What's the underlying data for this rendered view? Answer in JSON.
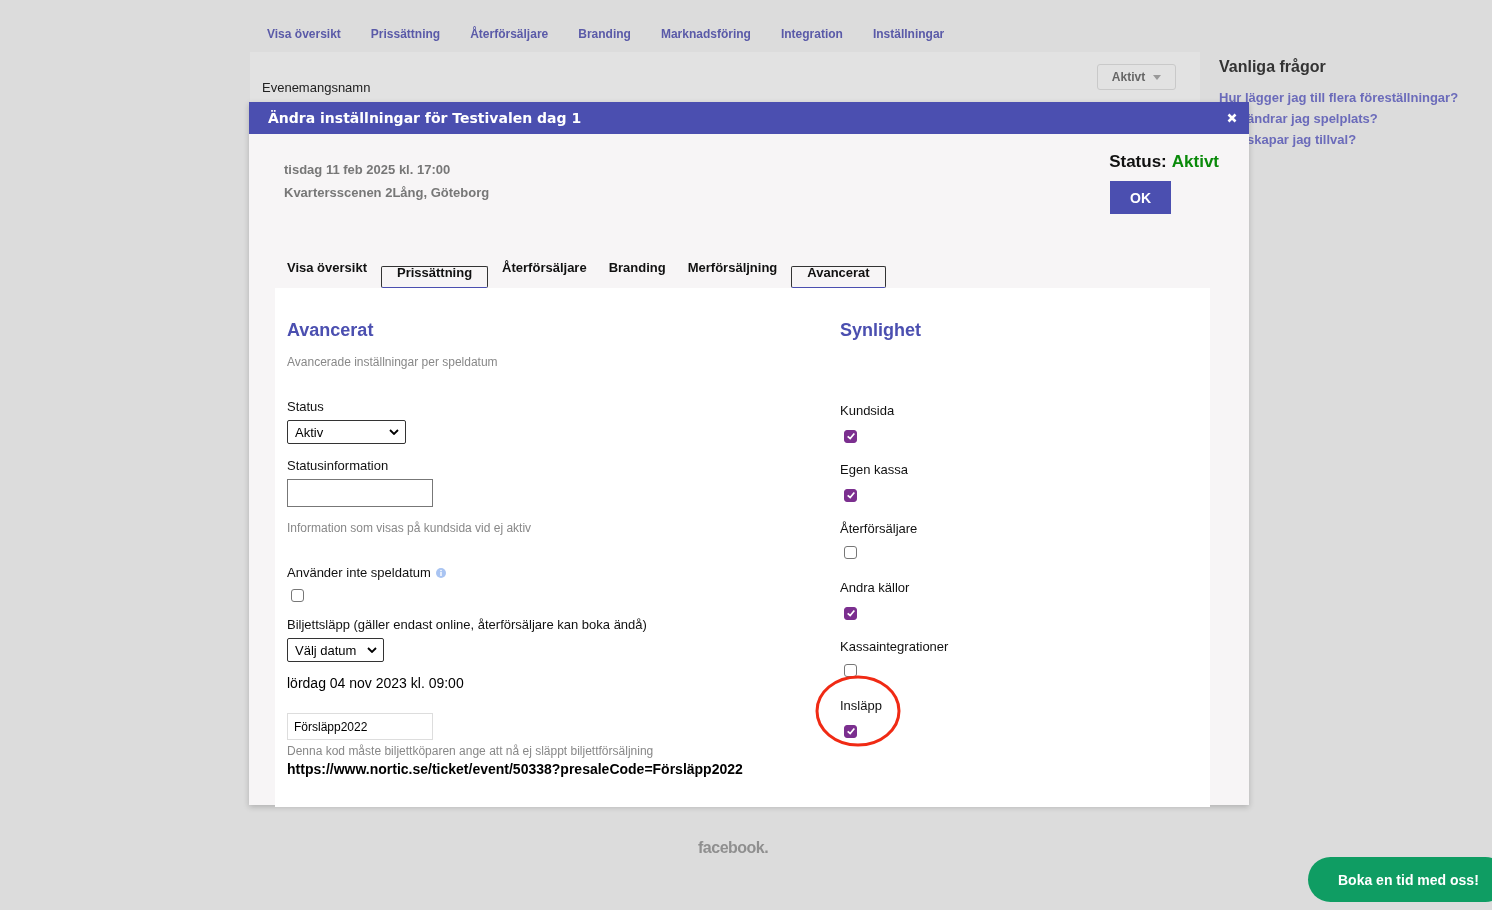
{
  "top_nav": [
    {
      "label": "Visa översikt"
    },
    {
      "label": "Prissättning"
    },
    {
      "label": "Återförsäljare"
    },
    {
      "label": "Branding"
    },
    {
      "label": "Marknadsföring"
    },
    {
      "label": "Integration"
    },
    {
      "label": "Inställningar"
    }
  ],
  "page": {
    "event_name_label": "Evenemangsnamn",
    "status_button": "Aktivt"
  },
  "faq": {
    "title": "Vanliga frågor",
    "links": [
      "Hur lägger jag till flera föreställningar?",
      "ändrar jag spelplats?",
      "skapar jag tillval?"
    ]
  },
  "footer": {
    "logo": "facebook."
  },
  "book_button": "Boka en tid med oss!",
  "modal": {
    "title": "Ändra inställningar för Testivalen dag 1",
    "date": "tisdag 11 feb 2025 kl. 17:00",
    "venue": "Kvartersscenen 2Lång, Göteborg",
    "status_label": "Status:",
    "status_value": "Aktivt",
    "ok_button": "OK",
    "tabs": [
      {
        "label": "Visa översikt",
        "selected": false
      },
      {
        "label": "Prissättning",
        "selected": true
      },
      {
        "label": "Återförsäljare",
        "selected": false
      },
      {
        "label": "Branding",
        "selected": false
      },
      {
        "label": "Merförsäljning",
        "selected": false
      },
      {
        "label": "Avancerat",
        "selected": true
      }
    ],
    "advanced": {
      "title": "Avancerat",
      "subtitle": "Avancerade inställningar per speldatum",
      "status_label": "Status",
      "status_select": "Aktiv",
      "status_info_label": "Statusinformation",
      "status_info_hint": "Information som visas på kundsida vid ej aktiv",
      "no_date_label": "Använder inte speldatum",
      "no_date_checked": false,
      "release_label": "Biljettsläpp (gäller endast online, återförsäljare kan boka ändå)",
      "release_select": "Välj datum",
      "release_date": "lördag 04 nov 2023 kl. 09:00",
      "code_value": "Försläpp2022",
      "code_hint": "Denna kod måste biljettköparen ange att nå ej släppt biljettförsäljning",
      "code_url": "https://www.nortic.se/ticket/event/50338?presaleCode=Försläpp2022"
    },
    "visibility": {
      "title": "Synlighet",
      "items": [
        {
          "label": "Kundsida",
          "checked": true,
          "highlighted": false
        },
        {
          "label": "Egen kassa",
          "checked": true,
          "highlighted": false
        },
        {
          "label": "Återförsäljare",
          "checked": false,
          "highlighted": false
        },
        {
          "label": "Andra källor",
          "checked": true,
          "highlighted": false
        },
        {
          "label": "Kassaintegrationer",
          "checked": false,
          "highlighted": false
        },
        {
          "label": "Insläpp",
          "checked": true,
          "highlighted": true
        }
      ]
    }
  }
}
